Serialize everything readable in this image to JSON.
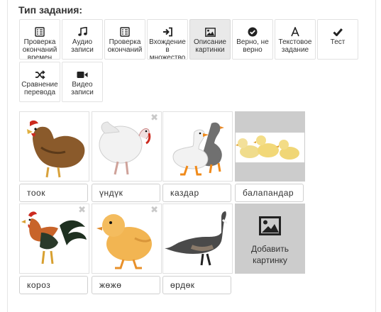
{
  "header": {
    "title": "Тип задания:"
  },
  "task_types": [
    {
      "label": "Проверка окончаний времен",
      "icon": "check-list-icon"
    },
    {
      "label": "Аудио записи",
      "icon": "music-icon"
    },
    {
      "label": "Проверка окончаний",
      "icon": "check-list-icon"
    },
    {
      "label": "Вхождение в множество",
      "icon": "sign-in-icon"
    },
    {
      "label": "Описание картинки",
      "icon": "picture-icon",
      "active": true
    },
    {
      "label": "Верно, не верно",
      "icon": "check-circle-icon"
    },
    {
      "label": "Текстовое задание",
      "icon": "font-icon"
    },
    {
      "label": "Тест",
      "icon": "check-mark-icon"
    },
    {
      "label": "Сравнение перевода",
      "icon": "shuffle-icon"
    },
    {
      "label": "Видео записи",
      "icon": "video-camera-icon"
    }
  ],
  "cards": [
    {
      "name": "тоок",
      "picture": "hen"
    },
    {
      "name": "үндүк",
      "picture": "turkey"
    },
    {
      "name": "каздар",
      "picture": "geese"
    },
    {
      "name": "балапандар",
      "picture": "ducklings"
    },
    {
      "name": "короз",
      "picture": "rooster"
    },
    {
      "name": "жөжө",
      "picture": "chick"
    },
    {
      "name": "өрдөк",
      "picture": "goose"
    }
  ],
  "add_picture": {
    "label": "Добавить картинку",
    "icon": "picture-icon"
  },
  "colors": {
    "tile_gray": "#cccccc",
    "active_button": "#e9e9e9",
    "text": "#333333"
  }
}
